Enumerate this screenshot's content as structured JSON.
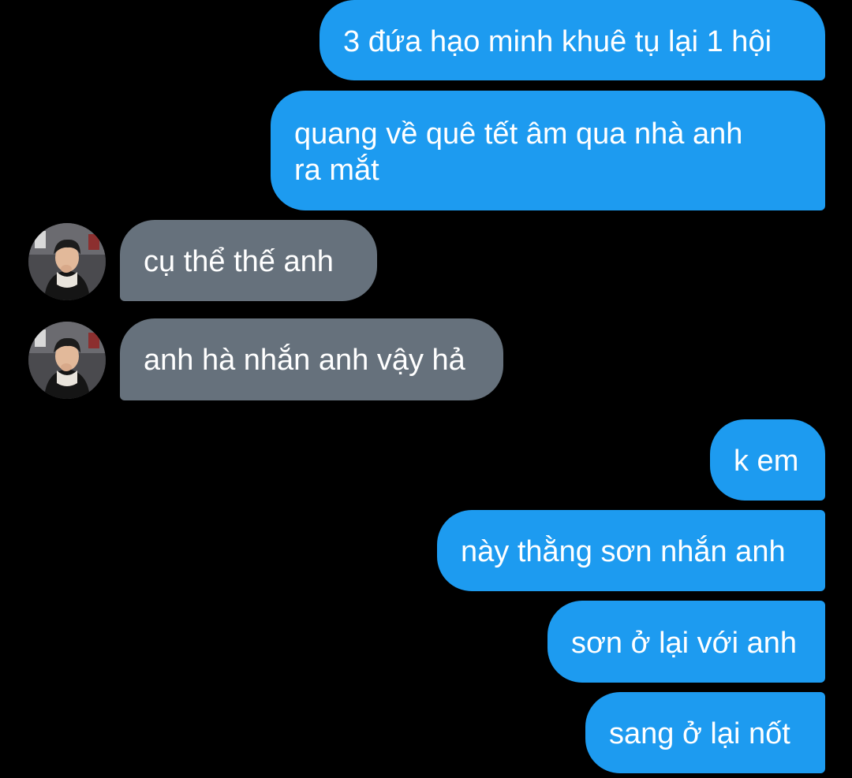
{
  "messages": [
    {
      "id": "m1",
      "direction": "outgoing",
      "text": "3 đứa hạo minh khuê tụ lại 1 hội"
    },
    {
      "id": "m2",
      "direction": "outgoing",
      "lines": [
        "quang về quê tết âm qua nhà anh",
        "ra mắt"
      ]
    },
    {
      "id": "m3",
      "direction": "incoming",
      "text": "cụ thể thế anh",
      "avatar": "contact-avatar"
    },
    {
      "id": "m4",
      "direction": "incoming",
      "text": "anh hà nhắn anh vậy hả",
      "avatar": "contact-avatar"
    },
    {
      "id": "m5",
      "direction": "outgoing",
      "text": "k em"
    },
    {
      "id": "m6",
      "direction": "outgoing",
      "text": "này thằng sơn nhắn anh"
    },
    {
      "id": "m7",
      "direction": "outgoing",
      "text": "sơn ở lại với anh"
    },
    {
      "id": "m8",
      "direction": "outgoing",
      "text": "sang ở lại nốt"
    }
  ],
  "colors": {
    "background": "#000000",
    "outgoing_bubble": "#1d9bf0",
    "incoming_bubble": "#66717c",
    "text": "#ffffff"
  }
}
